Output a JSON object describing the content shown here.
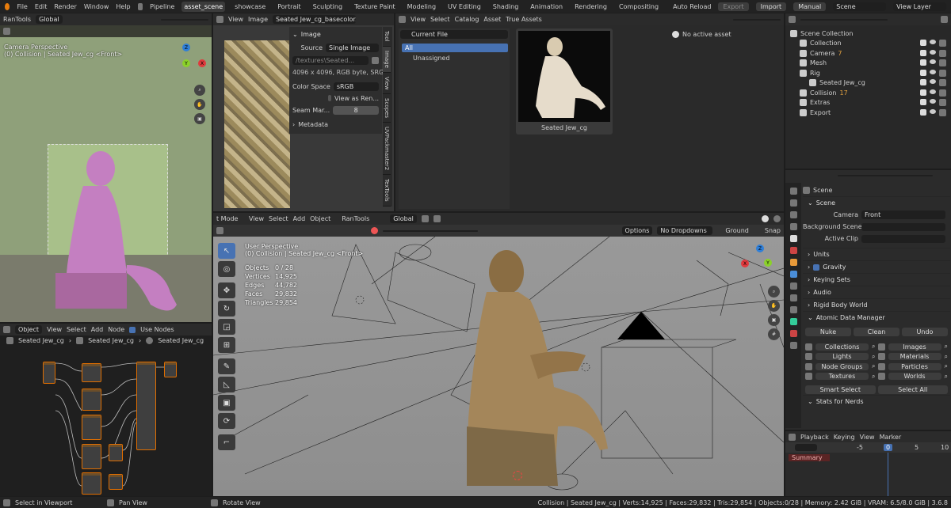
{
  "topbar": {
    "menus": [
      "File",
      "Edit",
      "Render",
      "Window",
      "Help"
    ],
    "pipeline": "Pipeline",
    "workspaces": [
      "asset_scene",
      "showcase",
      "Portrait",
      "Sculpting",
      "Texture Paint",
      "Modeling",
      "UV Editing",
      "Shading",
      "Animation",
      "Rendering",
      "Compositing"
    ],
    "auto_reload": "Auto Reload",
    "export": "Export",
    "import": "Import",
    "manual": "Manual",
    "scene": "Scene",
    "view_layer": "View Layer"
  },
  "camera_view": {
    "tools": "RanTools",
    "orientation": "Global",
    "title": "Camera Perspective",
    "subtitle": "(0) Collision | Seated Jew_cg <Front>"
  },
  "image_editor": {
    "view": "View",
    "image": "Image",
    "file": "Seated Jew_cg_basecolor.jpeg",
    "panel_title": "Image",
    "source_label": "Source",
    "source_value": "Single Image",
    "path": "/textures\\Seated...",
    "info": "4096 x 4096,  RGB byte,  SRG...",
    "color_space_label": "Color Space",
    "color_space_value": "sRGB",
    "view_as_render": "View as Ren...",
    "seam_label": "Seam Mar...",
    "seam_value": "8",
    "metadata": "Metadata",
    "tabs": [
      "Tool",
      "Image",
      "View",
      "Scopes",
      "UVPackmaster2",
      "TexTools"
    ]
  },
  "asset_browser": {
    "view": "View",
    "select": "Select",
    "catalog": "Catalog",
    "asset": "Asset",
    "true_assets": "True Assets",
    "library": "Current File",
    "catalog_all": "All",
    "catalog_unassigned": "Unassigned",
    "asset_name": "Seated Jew_cg",
    "no_active": "No active asset"
  },
  "outliner": {
    "items": [
      {
        "label": "Scene Collection",
        "indent": 0
      },
      {
        "label": "Collection",
        "indent": 1
      },
      {
        "label": "Camera",
        "indent": 1,
        "badge": "7"
      },
      {
        "label": "Mesh",
        "indent": 1
      },
      {
        "label": "Rig",
        "indent": 1
      },
      {
        "label": "Seated Jew_cg",
        "indent": 2
      },
      {
        "label": "Collision",
        "indent": 1,
        "badge": "17"
      },
      {
        "label": "Extras",
        "indent": 1
      },
      {
        "label": "Export",
        "indent": 1
      }
    ]
  },
  "properties": {
    "scene_label": "Scene",
    "scene_section": "Scene",
    "camera_label": "Camera",
    "camera_value": "Front",
    "bg_scene_label": "Background Scene",
    "active_clip_label": "Active Clip",
    "sections": [
      "Units",
      "Gravity",
      "Keying Sets",
      "Audio",
      "Rigid Body World",
      "Atomic Data Manager"
    ],
    "nuke": "Nuke",
    "clean": "Clean",
    "undo": "Undo",
    "grid_left": [
      "Collections",
      "Lights",
      "Node Groups",
      "Textures"
    ],
    "grid_right": [
      "Images",
      "Materials",
      "Particles",
      "Worlds"
    ],
    "smart_select": "Smart Select",
    "select_all": "Select All",
    "stats": "Stats for Nerds"
  },
  "node_editor": {
    "object": "Object",
    "view": "View",
    "select": "Select",
    "add": "Add",
    "node": "Node",
    "use_nodes": "Use Nodes",
    "crumbs": [
      "Seated Jew_cg",
      "Seated Jew_cg",
      "Seated Jew_cg"
    ]
  },
  "viewport": {
    "mode": "t Mode",
    "view": "View",
    "select": "Select",
    "add": "Add",
    "object": "Object",
    "tools": "RanTools",
    "orientation": "Global",
    "options": "Options",
    "dropdowns": "No Dropdowns",
    "ground": "Ground",
    "snap": "Snap",
    "title": "User Perspective",
    "subtitle": "(0) Collision | Seated Jew_cg <Front>",
    "stats": [
      {
        "k": "Objects",
        "v": "0 / 28"
      },
      {
        "k": "Vertices",
        "v": "14,925"
      },
      {
        "k": "Edges",
        "v": "44,782"
      },
      {
        "k": "Faces",
        "v": "29,832"
      },
      {
        "k": "Triangles",
        "v": "29,854"
      }
    ]
  },
  "timeline": {
    "playback": "Playback",
    "keying": "Keying",
    "view": "View",
    "marker": "Marker",
    "summary": "Summary",
    "ticks": [
      "-5",
      "0",
      "5",
      "10"
    ],
    "current": "0"
  },
  "statusbar": {
    "left": "Select in Viewport",
    "mid": "Pan View",
    "rotate": "Rotate View",
    "info": "Collision | Seated Jew_cg | Verts:14,925 | Faces:29,832 | Tris:29,854 | Objects:0/28 | Memory: 2.42 GiB | VRAM: 6.5/8.0 GiB | 3.6.8"
  },
  "colors": {
    "accent": "#4772b3",
    "node_border": "#e06e00",
    "select_cam": "#cf7b1e"
  }
}
